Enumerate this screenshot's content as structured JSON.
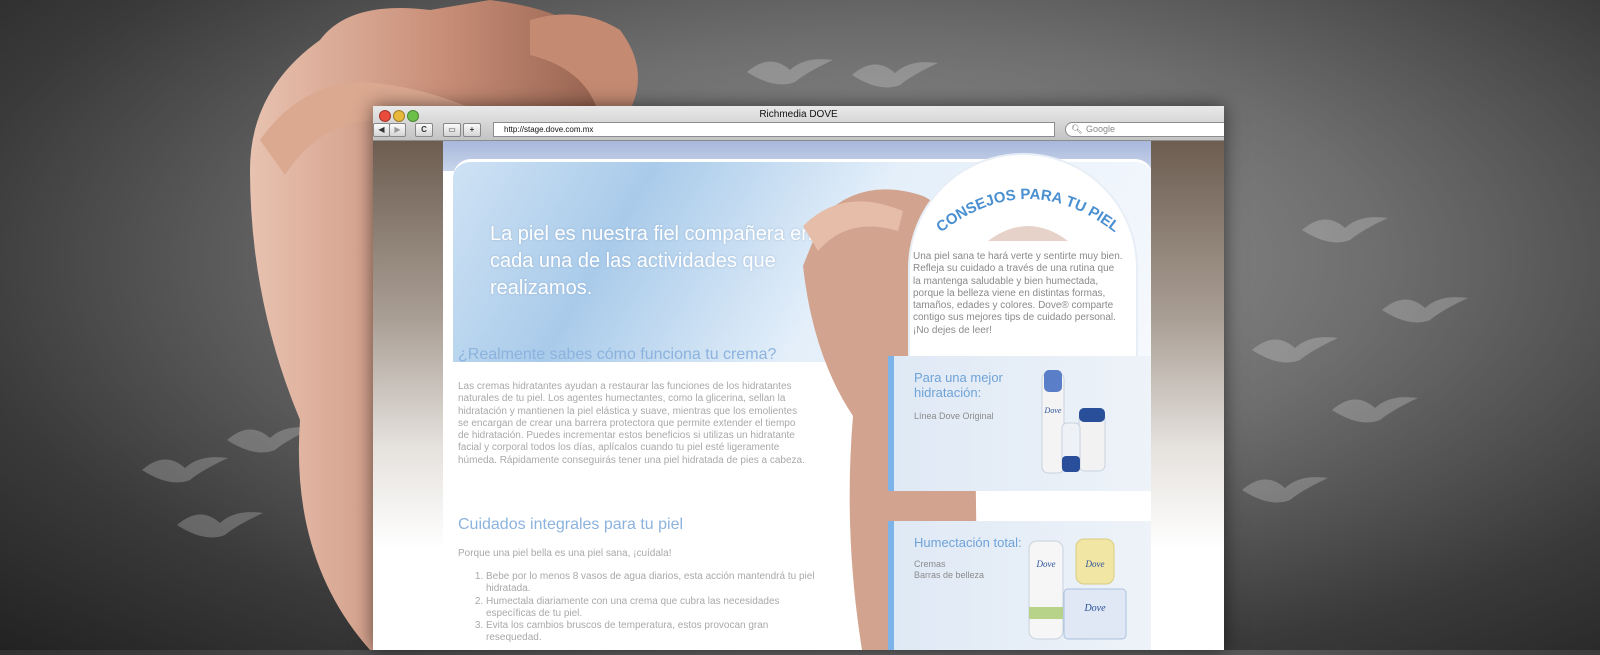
{
  "browser": {
    "window_title": "Richmedia DOVE",
    "url": "http://stage.dove.com.mx",
    "search_placeholder": "Google",
    "back_label": "◀",
    "forward_label": "▶",
    "reload_label": "C",
    "add_label": "+"
  },
  "site": {
    "hero_text": "La piel es nuestra fiel compañera en cada una de las actividades que realizamos.",
    "section1": {
      "title": "¿Realmente sabes cómo funciona tu crema?",
      "body": "Las cremas hidratantes ayudan a restaurar las funciones de los hidratantes naturales de tu piel. Los agentes humectantes, como la glicerina, sellan la hidratación y mantienen la piel elástica y suave, mientras que los emolientes se encargan de crear una barrera protectora que permite extender el tiempo de hidratación. Puedes incrementar estos beneficios si utilizas  un hidratante facial y corporal todos los días, aplícalos cuando tu piel esté ligeramente húmeda. Rápidamente conseguirás tener una piel hidratada de pies a cabeza."
    },
    "section2": {
      "title": "Cuidados integrales para tu piel",
      "intro": "Porque una piel bella es una piel sana,  ¡cuídala!",
      "items": [
        "Bebe por lo menos 8 vasos de agua diarios, esta acción mantendrá tu piel hidratada.",
        "Humectala diariamente con una crema que cubra las necesidades específicas de tu piel.",
        "Evita los cambios bruscos de temperatura, estos provocan gran resequedad."
      ]
    },
    "sidebar": {
      "heading": "CONSEJOS PARA TU PIEL",
      "intro": "Una piel sana te hará verte y sentirte muy bien. Refleja su cuidado a través de una rutina que la mantenga saludable y bien humectada, porque la belleza viene en distintas formas, tamaños, edades y colores. Dove® comparte contigo sus mejores tips de cuidado personal. ¡No dejes de leer!",
      "panels": [
        {
          "title": "Para una mejor hidratación:",
          "lines": [
            "Línea Dove Original"
          ],
          "product_brand": "Dove"
        },
        {
          "title": "Humectación total:",
          "lines": [
            "Cremas",
            "Barras de belleza"
          ],
          "product_brand": "Dove"
        }
      ]
    }
  },
  "colors": {
    "accent_blue": "#7cb3e8",
    "heading_blue": "#8cb3de",
    "body_gray": "#a9a9a9"
  }
}
